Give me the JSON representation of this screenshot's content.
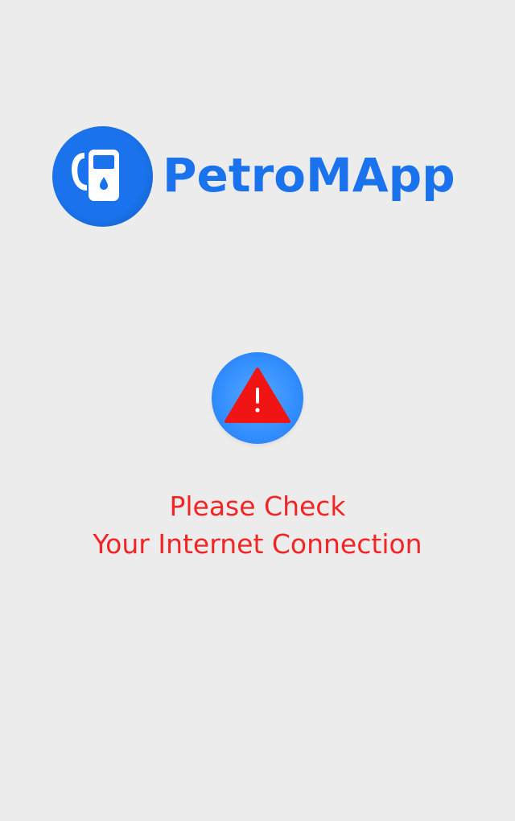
{
  "brand": {
    "name": "PetroMApp",
    "logo_icon": "fuel-pump-icon",
    "color": "#1a73ec"
  },
  "alert": {
    "icon": "warning-triangle-icon",
    "line1": "Please Check",
    "line2": "Your Internet Connection",
    "color": "#f22525"
  }
}
